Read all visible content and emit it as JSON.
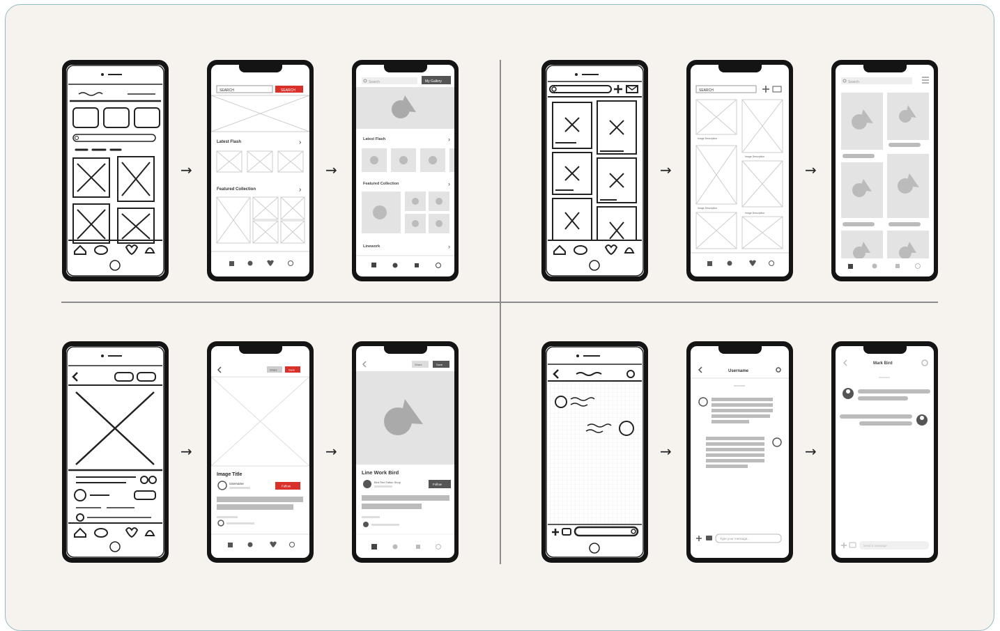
{
  "arrow_glyph": "→",
  "colors": {
    "accent": "#d9302a",
    "placeholder": "#c8c8c8",
    "bar": "#b9b9b9",
    "board": "#f6f3ee",
    "frame": "#141414"
  },
  "icons": [
    "home-icon",
    "eye-icon",
    "heart-icon",
    "profile-icon",
    "search-icon",
    "plus-icon",
    "mail-icon",
    "back-icon",
    "settings-icon",
    "camera-icon",
    "image-placeholder-icon"
  ],
  "browse_flow": {
    "search_field": "SEARCH",
    "search_button": "SEARCH",
    "section_latest": "Latest Flash",
    "section_featured": "Featured Collection",
    "hifi_search_placeholder": "Search",
    "hifi_button": "My Gallery",
    "hifi_section_latest": "Latest Flash",
    "hifi_section_featured": "Featured Collection",
    "hifi_section_linework": "Linework"
  },
  "grid_flow": {
    "search_field": "SEARCH",
    "caption": "Image Description",
    "hifi_search_placeholder": "Search"
  },
  "detail_flow": {
    "title": "Image Title",
    "username": "Username",
    "follow_button": "Follow",
    "save_button": "Save",
    "share_button": "Share",
    "hifi_title": "Line Work Bird",
    "hifi_artist": "Bird Red Tattoo Shop"
  },
  "chat_flow": {
    "header_username": "Username",
    "input_placeholder": "Type your message...",
    "hifi_header": "Mark Bird",
    "hifi_input_placeholder": "Send a message"
  }
}
